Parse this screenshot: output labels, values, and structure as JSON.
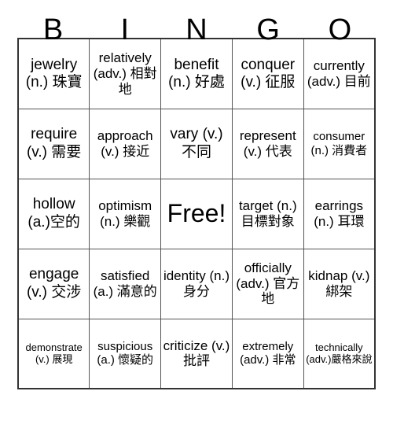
{
  "header": {
    "letters": [
      "B",
      "I",
      "N",
      "G",
      "O"
    ]
  },
  "grid": {
    "rows": [
      [
        {
          "text": "jewelry (n.) 珠寶",
          "size": "lg"
        },
        {
          "text": "relatively (adv.) 相對地",
          "size": "md"
        },
        {
          "text": "benefit (n.) 好處",
          "size": "lg"
        },
        {
          "text": "conquer (v.) 征服",
          "size": "lg"
        },
        {
          "text": "currently (adv.) 目前",
          "size": "md"
        }
      ],
      [
        {
          "text": "require (v.) 需要",
          "size": "lg"
        },
        {
          "text": "approach (v.) 接近",
          "size": "md"
        },
        {
          "text": "vary (v.) 不同",
          "size": "lg"
        },
        {
          "text": "represent (v.) 代表",
          "size": "md"
        },
        {
          "text": "consumer (n.) 消費者",
          "size": "sm"
        }
      ],
      [
        {
          "text": "hollow (a.)空的",
          "size": "lg"
        },
        {
          "text": "optimism (n.) 樂觀",
          "size": "md"
        },
        {
          "text": "Free!",
          "size": "xl"
        },
        {
          "text": "target (n.) 目標對象",
          "size": "md"
        },
        {
          "text": "earrings (n.) 耳環",
          "size": "md"
        }
      ],
      [
        {
          "text": "engage (v.) 交涉",
          "size": "lg"
        },
        {
          "text": "satisfied (a.) 滿意的",
          "size": "md"
        },
        {
          "text": "identity (n.) 身分",
          "size": "md"
        },
        {
          "text": "officially (adv.) 官方地",
          "size": "md"
        },
        {
          "text": "kidnap (v.) 綁架",
          "size": "md"
        }
      ],
      [
        {
          "text": "demonstrate (v.) 展現",
          "size": "xs"
        },
        {
          "text": "suspicious (a.) 懷疑的",
          "size": "sm"
        },
        {
          "text": "criticize (v.) 批評",
          "size": "md"
        },
        {
          "text": "extremely (adv.) 非常",
          "size": "sm"
        },
        {
          "text": "technically (adv.)嚴格來說",
          "size": "xs"
        }
      ]
    ]
  }
}
